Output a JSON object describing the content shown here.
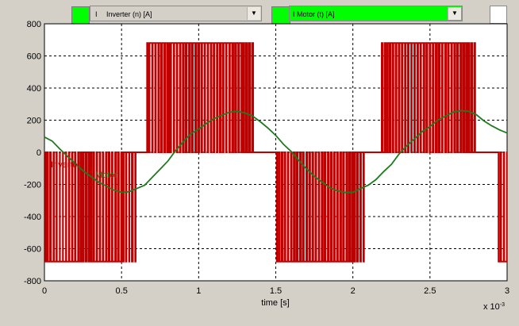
{
  "toolbar": {
    "signal1": {
      "prefix": "I",
      "label": "Inverter (n) [A]",
      "color": "#00ff00"
    },
    "signal2": {
      "prefix": "I",
      "label": "Motor (t) [A]",
      "color": "#00ff00"
    },
    "dropdown_icon": "chevron-down-icon"
  },
  "chart_data": {
    "type": "line",
    "xlabel": "time [s]",
    "x_multiplier": "x 10",
    "x_exponent": "-3",
    "xlim": [
      0,
      3
    ],
    "ylim": [
      -800,
      800
    ],
    "x_ticks": [
      "0",
      "0.5",
      "1",
      "1.5",
      "2",
      "2.5",
      "3"
    ],
    "y_ticks": [
      "800",
      "600",
      "400",
      "200",
      "0",
      "-200",
      "-400",
      "-600",
      "-800"
    ],
    "grid": true,
    "series": [
      {
        "name": "I Inverter (n) [A]",
        "color": "#c00000",
        "kind": "pwm",
        "amplitude": 680,
        "x": [
          0,
          0.02,
          0.04,
          0.06,
          0.08,
          0.1,
          0.12,
          0.14,
          0.16,
          0.18,
          0.2,
          0.22,
          0.24,
          0.26,
          0.28,
          0.3,
          0.32,
          0.34,
          0.36,
          0.38,
          0.4,
          0.42,
          0.44,
          0.46,
          0.48,
          0.5,
          0.52,
          0.54,
          0.56,
          0.58,
          0.6,
          0.62,
          0.64,
          0.66,
          0.68,
          0.7,
          0.72,
          0.74,
          0.76,
          0.78,
          0.8,
          0.82,
          0.84,
          0.86,
          0.88,
          0.9,
          0.92,
          0.94,
          0.96,
          0.98,
          1.0,
          1.02,
          1.04,
          1.06,
          1.08,
          1.1,
          1.12,
          1.14,
          1.16,
          1.18,
          1.2,
          1.22,
          1.24,
          1.26,
          1.28,
          1.3,
          1.32,
          1.34,
          1.36,
          1.38,
          1.4,
          1.42,
          1.44,
          1.46,
          1.48,
          1.5,
          1.52,
          1.54,
          1.56,
          1.58,
          1.6,
          1.62,
          1.64,
          1.66,
          1.68,
          1.7,
          1.72,
          1.74,
          1.76,
          1.78,
          1.8,
          1.82,
          1.84,
          1.86,
          1.88,
          1.9,
          1.92,
          1.94,
          1.96,
          1.98,
          2.0,
          2.02,
          2.04,
          2.06,
          2.08,
          2.1,
          2.12,
          2.14,
          2.16,
          2.18,
          2.2,
          2.22,
          2.24,
          2.26,
          2.28,
          2.3,
          2.32,
          2.34,
          2.36,
          2.38,
          2.4,
          2.42,
          2.44,
          2.46,
          2.48,
          2.5,
          2.52,
          2.54,
          2.56,
          2.58,
          2.6,
          2.62,
          2.64,
          2.66,
          2.68,
          2.7,
          2.72,
          2.74,
          2.76,
          2.78,
          2.8,
          2.82,
          2.84,
          2.86,
          2.88,
          2.9,
          2.92,
          2.94,
          2.96,
          2.98,
          3.0
        ],
        "duty": [
          0.35,
          0.65,
          0.85,
          0.8,
          0.95,
          0.95,
          0.95,
          0.85,
          0.8,
          0.75,
          0.8,
          0.55,
          0.45,
          0.35,
          0.5,
          0.55,
          0.75,
          0.8,
          0.8,
          0.85,
          0.65,
          0.75,
          0.85,
          0.65,
          0.75,
          0.4,
          0.2,
          0.1,
          0.35,
          0.15,
          0.0,
          0.0,
          0.0,
          0.45,
          0.85,
          0.8,
          0.8,
          0.65,
          0.7,
          0.6,
          0.45,
          0.85,
          0.8,
          0.8,
          0.7,
          0.6,
          0.7,
          0.6,
          0.75,
          0.6,
          0.65,
          0.75,
          0.8,
          0.8,
          0.7,
          0.8,
          0.7,
          0.65,
          0.8,
          0.85,
          0.7,
          0.55,
          0.65,
          0.7,
          0.4,
          0.5,
          0.4,
          0.35,
          0.25,
          0.0,
          0.0,
          0.0,
          0.0,
          0.0,
          0.0,
          0.35,
          0.6,
          0.65,
          0.75,
          0.8,
          0.65,
          0.55,
          0.7,
          0.6,
          0.8,
          0.65,
          0.7,
          0.7,
          0.8,
          0.75,
          0.55,
          0.75,
          0.65,
          0.7,
          0.75,
          0.7,
          0.6,
          0.75,
          0.55,
          0.55,
          0.45,
          0.35,
          0.25,
          0.2,
          0.15,
          0.0,
          0.0,
          0.0,
          0.0,
          0.3,
          0.4,
          0.55,
          0.65,
          0.7,
          0.7,
          0.7,
          0.75,
          0.7,
          0.8,
          0.8,
          0.75,
          0.7,
          0.8,
          0.6,
          0.75,
          0.75,
          0.7,
          0.55,
          0.75,
          0.8,
          0.6,
          0.8,
          0.7,
          0.6,
          0.7,
          0.55,
          0.55,
          0.45,
          0.4,
          0.3,
          0.25,
          0.2,
          0.0,
          0.0,
          0.0,
          0.0,
          0.5,
          0.55,
          0.85,
          0.85,
          0.0
        ],
        "polarity": [
          -1,
          -1,
          -1,
          -1,
          -1,
          -1,
          -1,
          -1,
          -1,
          -1,
          -1,
          -1,
          -1,
          -1,
          -1,
          -1,
          -1,
          -1,
          -1,
          -1,
          -1,
          -1,
          -1,
          -1,
          -1,
          -1,
          -1,
          -1,
          -1,
          -1,
          0,
          0,
          0,
          1,
          1,
          1,
          1,
          1,
          1,
          1,
          1,
          1,
          1,
          1,
          1,
          1,
          1,
          1,
          1,
          1,
          1,
          1,
          1,
          1,
          1,
          1,
          1,
          1,
          1,
          1,
          1,
          1,
          1,
          1,
          1,
          1,
          1,
          1,
          0,
          0,
          0,
          0,
          0,
          0,
          0,
          -1,
          -1,
          -1,
          -1,
          -1,
          -1,
          -1,
          -1,
          -1,
          -1,
          -1,
          -1,
          -1,
          -1,
          -1,
          -1,
          -1,
          -1,
          -1,
          -1,
          -1,
          -1,
          -1,
          -1,
          -1,
          -1,
          -1,
          -1,
          -1,
          0,
          0,
          0,
          0,
          0,
          1,
          1,
          1,
          1,
          1,
          1,
          1,
          1,
          1,
          1,
          1,
          1,
          1,
          1,
          1,
          1,
          1,
          1,
          1,
          1,
          1,
          1,
          1,
          1,
          1,
          1,
          1,
          1,
          1,
          1,
          1,
          0,
          0,
          0,
          0,
          0,
          0,
          0,
          -1,
          -1,
          -1,
          0
        ]
      },
      {
        "name": "I Motor (t) [A]",
        "color": "#1f7a1f",
        "x": [
          0,
          0.05,
          0.1,
          0.15,
          0.2,
          0.25,
          0.3,
          0.35,
          0.4,
          0.45,
          0.5,
          0.55,
          0.6,
          0.65,
          0.7,
          0.75,
          0.8,
          0.85,
          0.9,
          0.95,
          1.0,
          1.05,
          1.1,
          1.15,
          1.2,
          1.25,
          1.3,
          1.35,
          1.4,
          1.45,
          1.5,
          1.55,
          1.6,
          1.65,
          1.7,
          1.75,
          1.8,
          1.85,
          1.9,
          1.95,
          2.0,
          2.05,
          2.1,
          2.15,
          2.2,
          2.25,
          2.3,
          2.35,
          2.4,
          2.45,
          2.5,
          2.55,
          2.6,
          2.65,
          2.7,
          2.75,
          2.8,
          2.85,
          2.9,
          2.95,
          3.0
        ],
        "y": [
          95,
          70,
          20,
          -25,
          -70,
          -115,
          -150,
          -185,
          -210,
          -235,
          -250,
          -245,
          -225,
          -205,
          -155,
          -105,
          -55,
          10,
          65,
          115,
          145,
          180,
          210,
          230,
          250,
          255,
          245,
          225,
          190,
          150,
          105,
          50,
          5,
          -50,
          -105,
          -150,
          -185,
          -220,
          -240,
          -250,
          -250,
          -225,
          -205,
          -170,
          -120,
          -75,
          -10,
          40,
          85,
          130,
          160,
          200,
          225,
          250,
          260,
          255,
          235,
          195,
          165,
          140,
          120
        ]
      }
    ],
    "annotations": [
      "Inverter",
      "Motor"
    ]
  }
}
